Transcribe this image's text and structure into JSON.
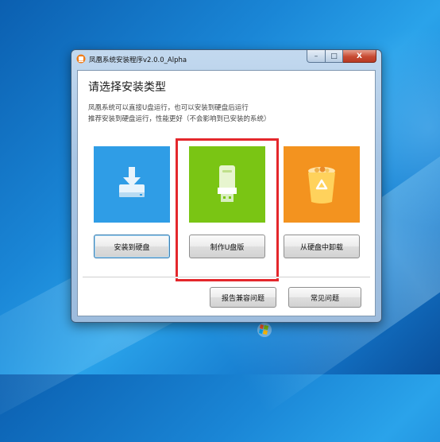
{
  "window": {
    "title": "凤凰系统安装程序v2.0.0_Alpha",
    "caption_buttons": {
      "minimize": "–",
      "maximize": "□",
      "close": "X"
    }
  },
  "dialog": {
    "heading": "请选择安装类型",
    "desc_line1": "凤凰系统可以直接U盘运行，也可以安装到硬盘后运行",
    "desc_line2": "推荐安装到硬盘运行，性能更好（不会影响到已安装的系统）"
  },
  "options": [
    {
      "label": "安装到硬盘",
      "color": "#2f9de6",
      "icon": "drive-download-icon"
    },
    {
      "label": "制作U盘版",
      "color": "#7ac514",
      "icon": "usb-drive-icon"
    },
    {
      "label": "从硬盘中卸载",
      "color": "#f3931f",
      "icon": "recycle-bin-icon"
    }
  ],
  "footer": {
    "report_label": "报告兼容问题",
    "faq_label": "常见问题"
  },
  "highlight_color": "#e4272c"
}
